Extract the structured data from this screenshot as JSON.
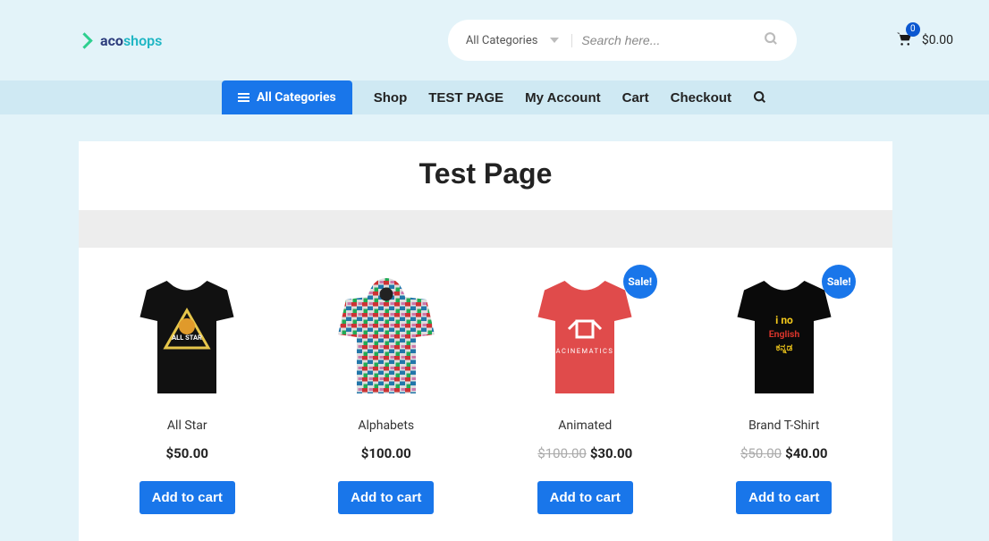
{
  "logo": {
    "text_a": "aco",
    "text_b": "shops"
  },
  "search": {
    "category_label": "All Categories",
    "placeholder": "Search here..."
  },
  "cart": {
    "count": "0",
    "total": "$0.00"
  },
  "nav": {
    "all_label": "All Categories",
    "items": [
      {
        "label": "Shop",
        "active": false
      },
      {
        "label": "TEST PAGE",
        "active": true
      },
      {
        "label": "My Account",
        "active": false
      },
      {
        "label": "Cart",
        "active": false
      },
      {
        "label": "Checkout",
        "active": false
      }
    ]
  },
  "page": {
    "title": "Test Page"
  },
  "sale_label": "Sale!",
  "products": [
    {
      "name": "All Star",
      "price": "$50.00",
      "old_price": null,
      "sale": false,
      "button": "Add to cart"
    },
    {
      "name": "Alphabets",
      "price": "$100.00",
      "old_price": null,
      "sale": false,
      "button": "Add to cart"
    },
    {
      "name": "Animated",
      "price": "$30.00",
      "old_price": "$100.00",
      "sale": true,
      "button": "Add to cart"
    },
    {
      "name": "Brand T-Shirt",
      "price": "$40.00",
      "old_price": "$50.00",
      "sale": true,
      "button": "Add to cart"
    }
  ]
}
